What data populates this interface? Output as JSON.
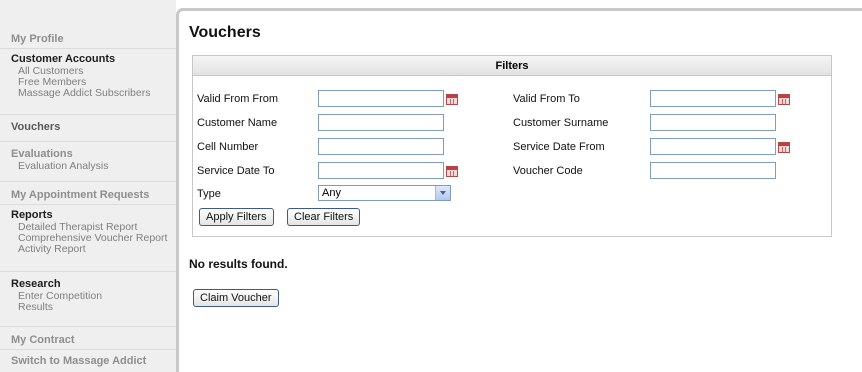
{
  "sidebar": {
    "my_profile": "My Profile",
    "customer_accounts": {
      "title": "Customer Accounts",
      "items": [
        "All Customers",
        "Free Members",
        "Massage Addict Subscribers"
      ]
    },
    "vouchers": "Vouchers",
    "evaluations": {
      "title": "Evaluations",
      "items": [
        "Evaluation Analysis"
      ]
    },
    "appointment_requests": "My Appointment Requests",
    "reports": {
      "title": "Reports",
      "items": [
        "Detailed Therapist Report",
        "Comprehensive Voucher Report",
        "Activity Report"
      ]
    },
    "research": {
      "title": "Research",
      "items": [
        "Enter Competition",
        "Results"
      ]
    },
    "my_contract": "My Contract",
    "switch": "Switch to Massage Addict"
  },
  "main": {
    "title": "Vouchers",
    "filters": {
      "header": "Filters",
      "valid_from_from": {
        "label": "Valid From From",
        "value": ""
      },
      "valid_from_to": {
        "label": "Valid From To",
        "value": ""
      },
      "customer_name": {
        "label": "Customer Name",
        "value": ""
      },
      "customer_surname": {
        "label": "Customer Surname",
        "value": ""
      },
      "cell_number": {
        "label": "Cell Number",
        "value": ""
      },
      "service_date_from": {
        "label": "Service Date From",
        "value": ""
      },
      "service_date_to": {
        "label": "Service Date To",
        "value": ""
      },
      "voucher_code": {
        "label": "Voucher Code",
        "value": ""
      },
      "type": {
        "label": "Type",
        "selected": "Any"
      },
      "apply_label": "Apply Filters",
      "clear_label": "Clear Filters"
    },
    "no_results": "No results found.",
    "claim_label": "Claim Voucher"
  },
  "colors": {
    "sidebar_bg": "#efefef",
    "panel_border": "#c8c8c8",
    "input_border": "#7f9db9",
    "button_border": "#3c5a8e"
  }
}
